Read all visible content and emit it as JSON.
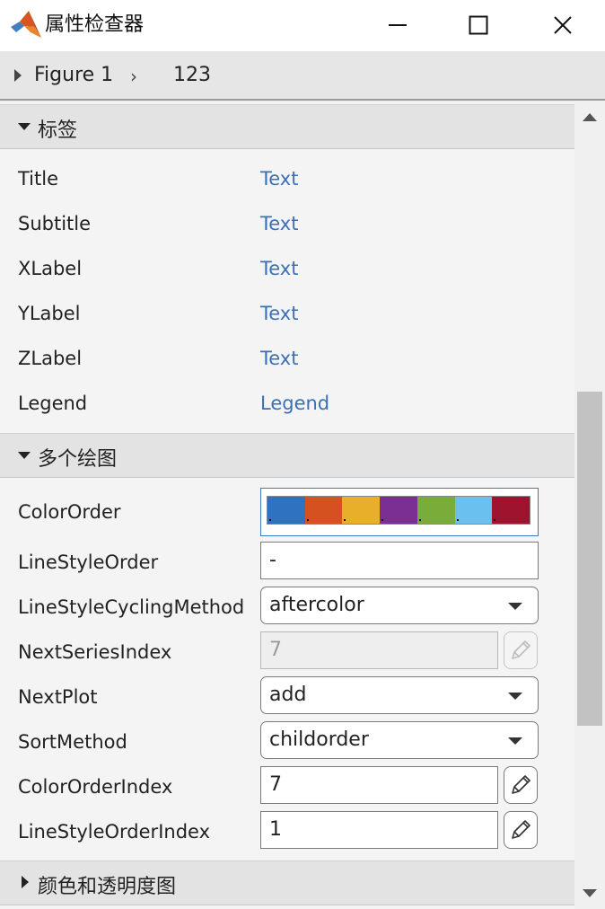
{
  "window": {
    "title": "属性检查器",
    "logo_icon": "matlab-logo-icon",
    "buttons": {
      "minimize_icon": "minimize-icon",
      "maximize_icon": "maximize-icon",
      "close_icon": "close-icon"
    }
  },
  "breadcrumb": {
    "figure": "Figure 1",
    "object": "123",
    "expand_icon": "triangle-right-icon",
    "separator_icon": "chevron-right-icon"
  },
  "sections": [
    {
      "label": "标签",
      "expanded": true,
      "rows": [
        {
          "name": "Title",
          "value": "Text"
        },
        {
          "name": "Subtitle",
          "value": "Text"
        },
        {
          "name": "XLabel",
          "value": "Text"
        },
        {
          "name": "YLabel",
          "value": "Text"
        },
        {
          "name": "ZLabel",
          "value": "Text"
        },
        {
          "name": "Legend",
          "value": "Legend"
        }
      ]
    },
    {
      "label": "多个绘图",
      "expanded": true,
      "rows": [
        {
          "name": "ColorOrder",
          "colors": [
            "#2f72c0",
            "#d55220",
            "#e8b02a",
            "#7b2f92",
            "#7aac3a",
            "#6ac0ef",
            "#a0132e"
          ]
        },
        {
          "name": "LineStyleOrder",
          "value": "-"
        },
        {
          "name": "LineStyleCyclingMethod",
          "value": "aftercolor"
        },
        {
          "name": "NextSeriesIndex",
          "value": "7"
        },
        {
          "name": "NextPlot",
          "value": "add"
        },
        {
          "name": "SortMethod",
          "value": "childorder"
        },
        {
          "name": "ColorOrderIndex",
          "value": "7"
        },
        {
          "name": "LineStyleOrderIndex",
          "value": "1"
        }
      ]
    },
    {
      "label": "颜色和透明度图",
      "expanded": false
    }
  ],
  "colors": {
    "link": "#3a70b8",
    "focus_border": "#3a7cc0",
    "section_bg": "#e3e3e3"
  }
}
